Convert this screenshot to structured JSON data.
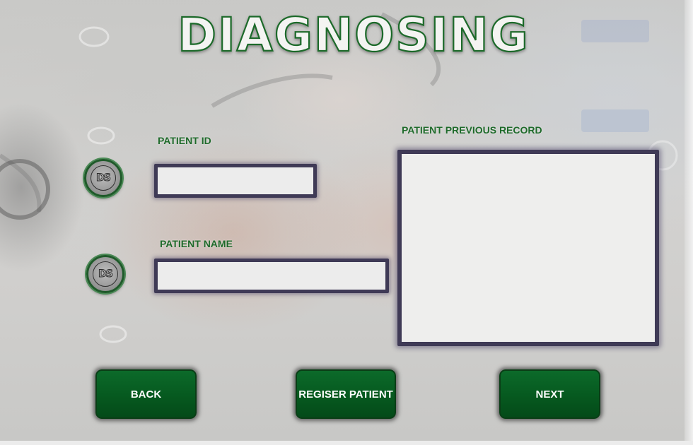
{
  "screen": {
    "title": "DIAGNOSING",
    "accent_color": "#06591f",
    "field_border_color": "#3f3a56"
  },
  "patient_id": {
    "label": "PATIENT ID",
    "value": "",
    "badge_icon": "ds-logo-icon",
    "badge_text": "DS"
  },
  "patient_name": {
    "label": "PATIENT NAME",
    "value": "",
    "badge_icon": "ds-logo-icon",
    "badge_text": "DS"
  },
  "previous_record": {
    "label": "PATIENT PREVIOUS RECORD",
    "value": ""
  },
  "buttons": {
    "back": "BACK",
    "register": "REGISER PATIENT",
    "next": "NEXT"
  }
}
